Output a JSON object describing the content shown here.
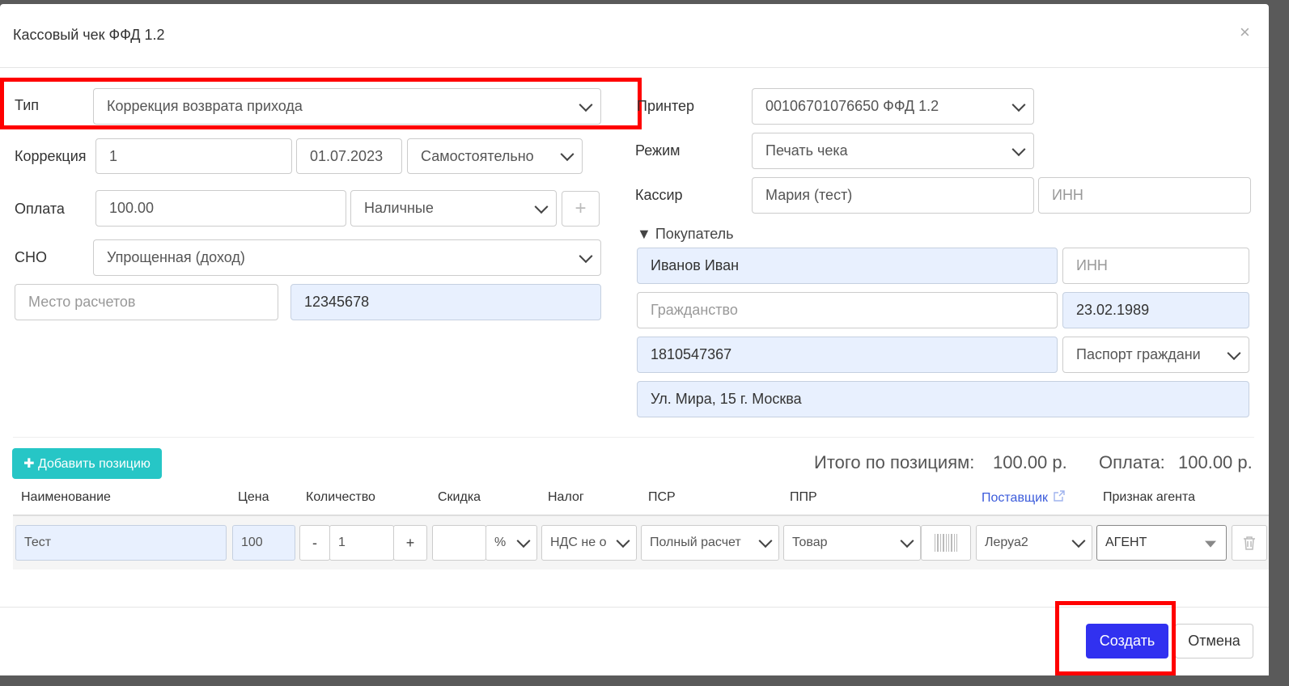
{
  "dialog": {
    "title": "Кассовый чек ФФД 1.2",
    "close_label": "×"
  },
  "form": {
    "type_label": "Тип",
    "type_value": "Коррекция возврата прихода",
    "correction_label": "Коррекция",
    "correction_number": "1",
    "correction_date": "01.07.2023",
    "correction_kind": "Самостоятельно",
    "payment_label": "Оплата",
    "payment_amount": "100.00",
    "payment_method": "Наличные",
    "add_payment_label": "+",
    "sno_label": "СНО",
    "sno_value": "Упрощенная (доход)",
    "place_placeholder": "Место расчетов",
    "place_code": "12345678"
  },
  "right": {
    "printer_label": "Принтер",
    "printer_value": "00106701076650 ФФД 1.2",
    "mode_label": "Режим",
    "mode_value": "Печать чека",
    "cashier_label": "Кассир",
    "cashier_name": "Мария (тест)",
    "cashier_inn_placeholder": "ИНН",
    "buyer_toggle": "▼ Покупатель",
    "buyer_name": "Иванов Иван",
    "buyer_inn_placeholder": "ИНН",
    "citizenship_placeholder": "Гражданство",
    "birth_date": "23.02.1989",
    "document_number": "1810547367",
    "document_type": "Паспорт граждани",
    "address": "Ул. Мира, 15 г. Москва"
  },
  "positions": {
    "add_label": "✚ Добавить позицию",
    "total_label": "Итого по позициям:",
    "total_value": "100.00 р.",
    "payment_label": "Оплата:",
    "payment_value": "100.00 р.",
    "headers": {
      "name": "Наименование",
      "price": "Цена",
      "quantity": "Количество",
      "discount": "Скидка",
      "tax": "Налог",
      "psr": "ПСР",
      "ppr": "ППР",
      "supplier": "Поставщик",
      "agent": "Признак агента"
    },
    "row": {
      "name": "Тест",
      "price": "100",
      "minus": "-",
      "quantity": "1",
      "plus": "+",
      "discount": "",
      "discount_unit": "%",
      "tax": "НДС не о",
      "psr": "Полный расчет",
      "ppr": "Товар",
      "supplier": "Леруа2",
      "agent": "АГЕНТ"
    }
  },
  "footer": {
    "create_label": "Создать",
    "cancel_label": "Отмена"
  },
  "colors": {
    "primary": "#3131f0",
    "accent": "#26c6c6",
    "highlight": "#ff0000",
    "filled_bg": "#e8f0fe"
  }
}
